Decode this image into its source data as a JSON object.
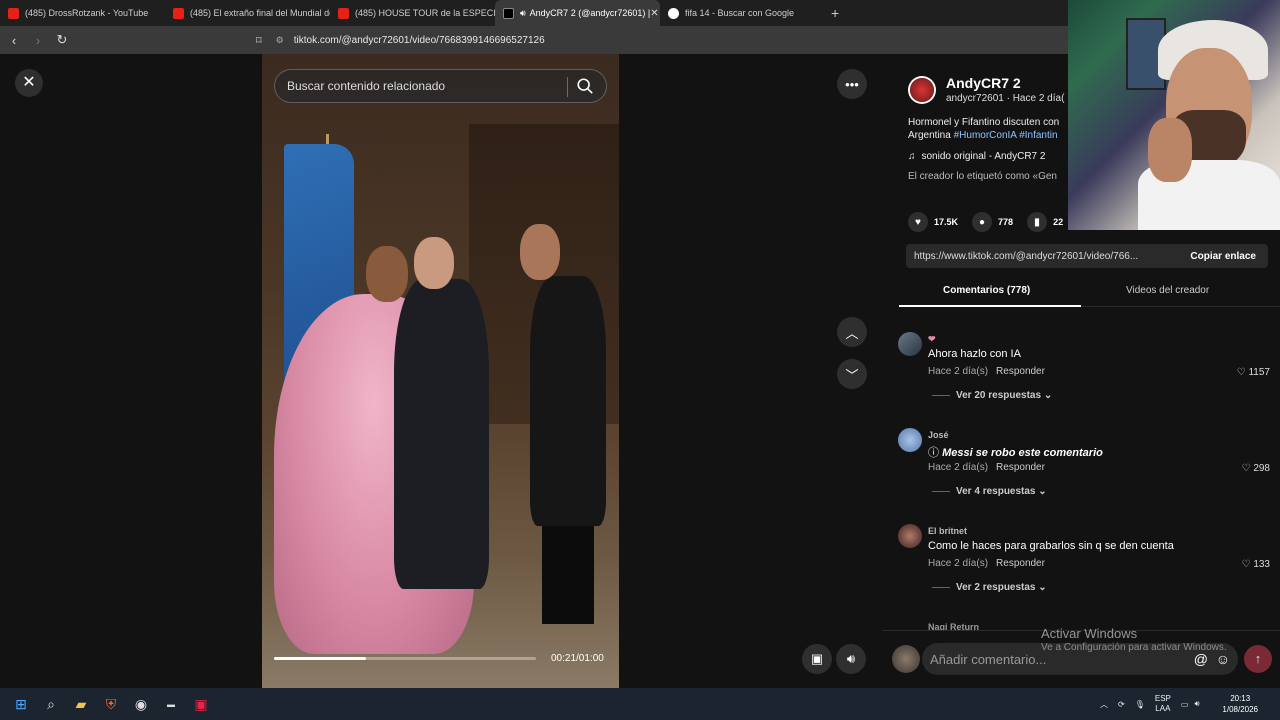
{
  "browser": {
    "tabs": [
      {
        "label": "(485) DrossRotzank - YouTube",
        "favicon": "youtube-icon"
      },
      {
        "label": "(485) El extraño final del Mundial de",
        "favicon": "youtube-icon"
      },
      {
        "label": "(485) HOUSE TOUR de la ESPECIAL H",
        "favicon": "youtube-icon"
      },
      {
        "label": "AndyCR7 2 (@andycr72601) |",
        "favicon": "tiktok-icon",
        "active": true
      },
      {
        "label": "fifa 14 - Buscar con Google",
        "favicon": "google-icon"
      }
    ],
    "url": "tiktok.com/@andycr72601/video/7668399146696527126"
  },
  "video": {
    "search_placeholder": "Buscar contenido relacionado",
    "time": "00:21/01:00",
    "progress": 0.35
  },
  "creator": {
    "name": "AndyCR7 2",
    "handle_line": "andycr72601 · Hace 2 día(",
    "description_text": "Hormonel y Fifantino discuten con",
    "description_country": "Argentina",
    "hashtag1": "#HumorConIA",
    "hashtag2": "#Infantin",
    "music": "sonido original - AndyCR7 2",
    "tagged": "El creador lo etiquetó como «Gen"
  },
  "stats": {
    "likes": "17.5K",
    "comments": "778",
    "saves": "22"
  },
  "share": {
    "link": "https://www.tiktok.com/@andycr72601/video/766...",
    "copy_label": "Copiar enlace"
  },
  "panel_tabs": {
    "comments": "Comentarios (778)",
    "creator_videos": "Videos del creador"
  },
  "comments": [
    {
      "name": "❤",
      "text": "Ahora hazlo con IA",
      "time": "Hace 2 día(s)",
      "reply": "Responder",
      "likes": "1157",
      "more": "Ver 20 respuestas"
    },
    {
      "name": "José",
      "text": "Messi se robo este comentario",
      "time": "Hace 2 día(s)",
      "reply": "Responder",
      "likes": "298",
      "more": "Ver 4 respuestas"
    },
    {
      "name": "El britnet",
      "text": "Como le haces para grabarlos sin q se den cuenta",
      "time": "Hace 2 día(s)",
      "reply": "Responder",
      "likes": "133",
      "more": "Ver 2 respuestas"
    }
  ],
  "partial_comment_name": "Nagi Return",
  "comment_input_placeholder": "Añadir comentario...",
  "windows_watermark": {
    "title": "Activar Windows",
    "subtitle": "Ve a Configuración para activar Windows."
  },
  "taskbar": {
    "lang": "ESP",
    "lang2": "LAA",
    "time": "20:13",
    "date": "1/08/2026"
  },
  "colors": {
    "accent": "#fe2c55",
    "hashtag": "#8fc4ff",
    "background": "#121212"
  }
}
